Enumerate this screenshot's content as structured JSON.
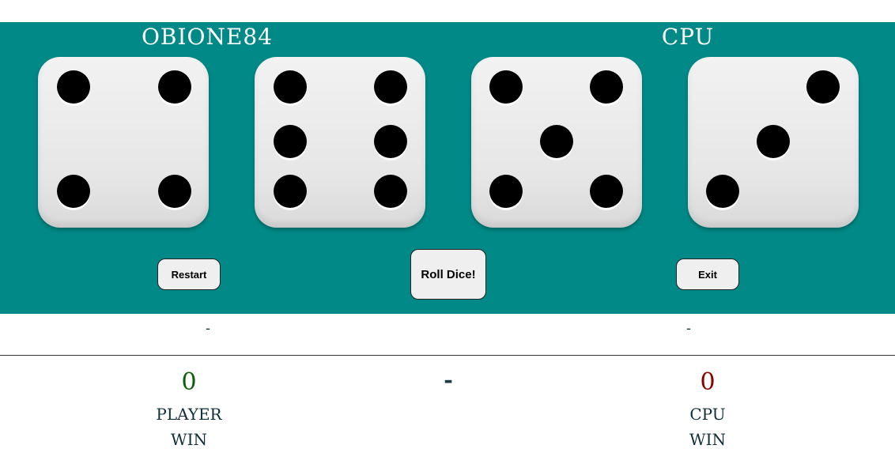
{
  "players": {
    "player_name": "OBIONE84",
    "cpu_name": "CPU"
  },
  "dice": [
    {
      "owner": "player",
      "value": 4
    },
    {
      "owner": "player",
      "value": 6
    },
    {
      "owner": "cpu",
      "value": 5
    },
    {
      "owner": "cpu",
      "value": 3
    }
  ],
  "buttons": {
    "restart": "Restart",
    "roll": "Roll Dice!",
    "exit": "Exit"
  },
  "round_result": {
    "player": "-",
    "cpu": "-",
    "center": "-"
  },
  "scoreboard": {
    "player_wins": "0",
    "cpu_wins": "0",
    "player_label": "PLAYER",
    "cpu_label": "CPU",
    "win_label": "WIN"
  },
  "colors": {
    "board": "#008986",
    "player_score": "#0b5e0b",
    "cpu_score": "#8b0000",
    "pip": "#000000"
  }
}
